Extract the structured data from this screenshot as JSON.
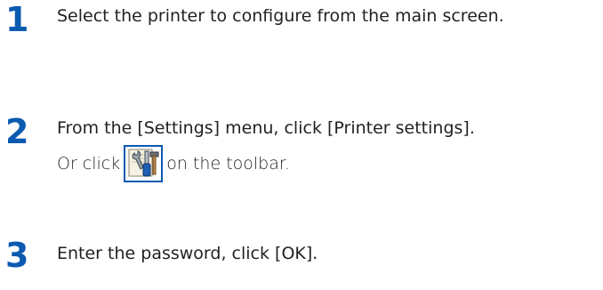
{
  "steps": [
    {
      "number": "1",
      "text": "Select the printer to configure from the main screen."
    },
    {
      "number": "2",
      "text": "From the [Settings] menu, click [Printer settings].",
      "sub_before": "Or click",
      "sub_icon": "printer-settings-tools-icon",
      "sub_after": "on the toolbar."
    },
    {
      "number": "3",
      "text": "Enter the password, click [OK]."
    }
  ],
  "colors": {
    "accent": "#0a5ab0",
    "text": "#231f20"
  }
}
